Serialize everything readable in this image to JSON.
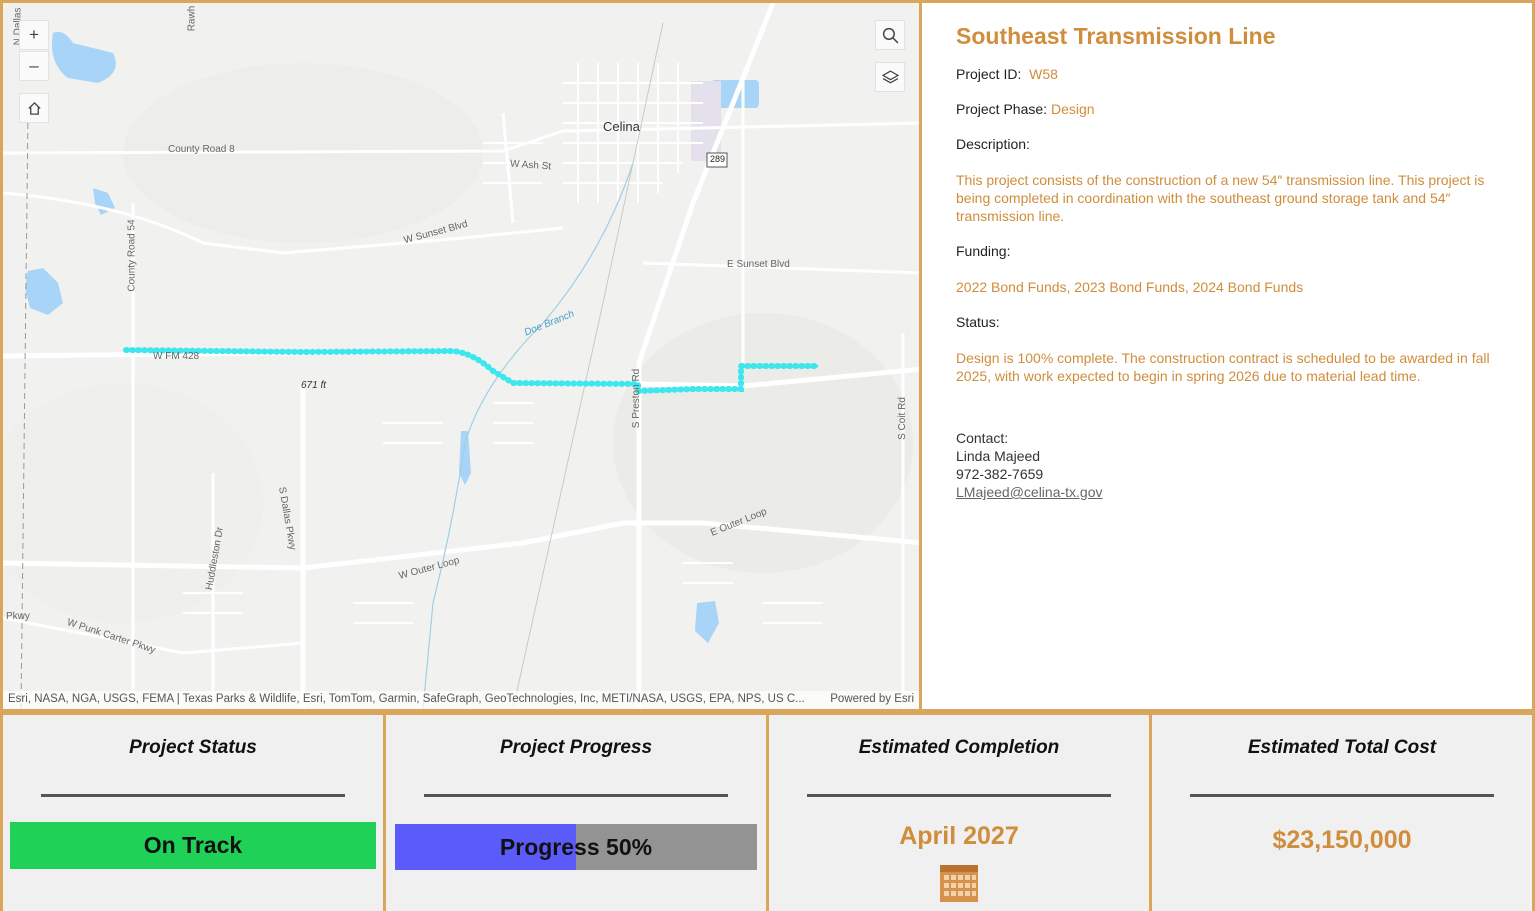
{
  "map": {
    "zoom_in_label": "+",
    "zoom_out_label": "–",
    "labels": {
      "city": "Celina",
      "county_road_8": "County Road 8",
      "w_ash": "W Ash St",
      "hwy_289": "289",
      "w_sunset": "W Sunset Blvd",
      "county_road_54": "County Road 54",
      "e_sunset": "E Sunset Blvd",
      "doe_branch": "Doe Branch",
      "w_fm_428": "W FM 428",
      "elev": "671 ft",
      "s_preston": "S Preston Rd",
      "s_coit": "S Coit Rd",
      "s_dallas": "S Dallas Pkwy",
      "huddleston": "Huddleston Dr",
      "w_outer_loop": "W Outer Loop",
      "e_outer_loop": "E Outer Loop",
      "w_punk_carter": "W Punk Carter Pkwy",
      "pkwy": "Pkwy",
      "rawh": "Rawh",
      "n_dallas": "N Dallas"
    },
    "attribution": "Esri, NASA, NGA, USGS, FEMA | Texas Parks & Wildlife, Esri, TomTom, Garmin, SafeGraph, GeoTechnologies, Inc, METI/NASA, USGS, EPA, NPS, US C...",
    "powered_by": "Powered by Esri",
    "line_color": "#3ee6ee"
  },
  "info": {
    "title": "Southeast Transmission Line",
    "project_id_label": "Project ID:",
    "project_id": "W58",
    "phase_label": "Project Phase:",
    "phase": "Design",
    "description_label": "Description:",
    "description": "This project consists of the construction of a new 54″ transmission line. This project is being completed in coordination with the southeast ground storage tank and 54″ transmission line.",
    "funding_label": "Funding:",
    "funding": "2022 Bond Funds, 2023 Bond Funds, 2024 Bond Funds",
    "status_label": "Status:",
    "status": "Design is 100% complete. The construction contract is scheduled to be awarded in fall 2025, with work expected to begin in spring 2026 due to material lead time.",
    "contact_label": "Contact:",
    "contact_name": "Linda Majeed",
    "contact_phone": "972-382-7659",
    "contact_email": "LMajeed@celina-tx.gov",
    "accent_color": "#d08d3c"
  },
  "cards": {
    "status_title": "Project Status",
    "status_value": "On Track",
    "status_color": "#1fd156",
    "progress_title": "Project Progress",
    "progress_text": "Progress 50%",
    "progress_fraction": 0.5,
    "completion_title": "Estimated Completion",
    "completion_value": "April 2027",
    "cost_title": "Estimated Total Cost",
    "cost_value": "$23,150,000"
  }
}
